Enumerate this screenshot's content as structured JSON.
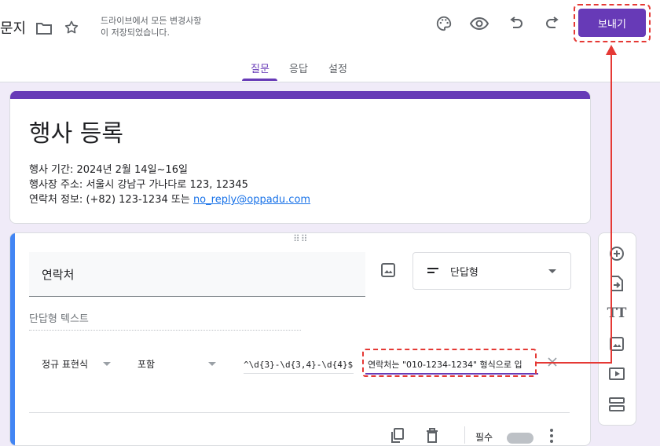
{
  "header": {
    "doc_title": "문지",
    "save_status_line1": "드라이브에서 모든 변경사항",
    "save_status_line2": "이 저장되었습니다.",
    "send_label": "보내기",
    "tabs": [
      {
        "label": "질문",
        "active": true
      },
      {
        "label": "응답",
        "active": false
      },
      {
        "label": "설정",
        "active": false
      }
    ],
    "icons": [
      "folder-icon",
      "star-icon",
      "palette-icon",
      "preview-icon",
      "undo-icon",
      "redo-icon"
    ]
  },
  "form": {
    "title": "행사 등록",
    "description": {
      "line1": "행사 기간: 2024년 2월 14일~16일",
      "line2": "행사장 주소: 서울시 강남구 가나다로 123, 12345",
      "line3_prefix": "연락처 정보: (+82) 123-1234 또는 ",
      "email": "no_reply@oppadu.com"
    }
  },
  "question": {
    "title": "연락처",
    "type": "단답형",
    "answer_placeholder": "단답형 텍스트",
    "validation": {
      "type": "정규 표현식",
      "condition": "포함",
      "pattern": "^\\d{3}-\\d{3,4}-\\d{4}$",
      "error_text": "연락처는 \"010-1234-1234\" 형식으로 입"
    },
    "required_label": "필수",
    "required": false
  },
  "toolbar": {
    "items": [
      "add-question-icon",
      "import-questions-icon",
      "add-title-icon",
      "add-image-icon",
      "add-video-icon",
      "add-section-icon"
    ],
    "title_glyph": "TT"
  },
  "colors": {
    "accent": "#673ab7",
    "background": "#f0ebf8",
    "question_accent": "#4285f4",
    "annotation": "#e53935"
  }
}
